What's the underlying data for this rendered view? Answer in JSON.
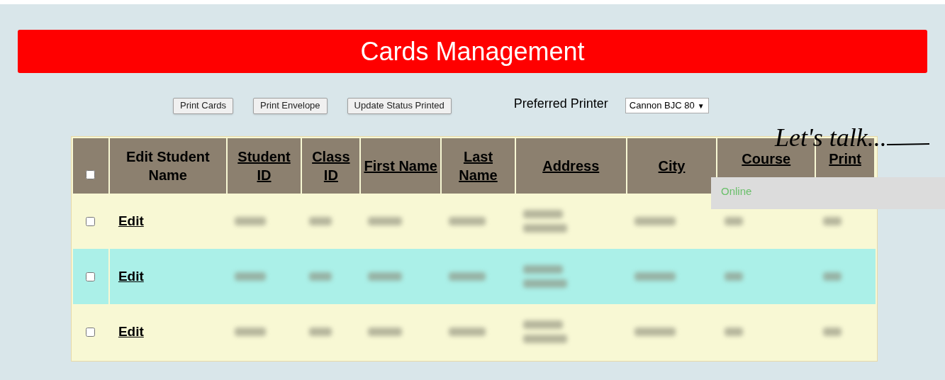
{
  "banner": {
    "title": "Cards Management"
  },
  "toolbar": {
    "buttons": [
      "Print Cards",
      "Print Envelope",
      "Update Status Printed"
    ],
    "printer_label": "Preferred Printer",
    "printer_value": "Cannon BJC 80",
    "dropdown_arrow": "▼"
  },
  "table": {
    "select_all": {
      "checked": false
    },
    "columns": [
      {
        "label": "Edit Student Name",
        "sortable": false
      },
      {
        "label": "Student ID",
        "sortable": true
      },
      {
        "label": "Class ID",
        "sortable": true
      },
      {
        "label": "First Name",
        "sortable": true
      },
      {
        "label": "Last Name",
        "sortable": true
      },
      {
        "label": "Address",
        "sortable": true
      },
      {
        "label": "City",
        "sortable": true
      },
      {
        "label": "Course",
        "sortable": true
      },
      {
        "label": "Print",
        "sortable": true
      }
    ],
    "rows": [
      {
        "checked": false,
        "selected": false,
        "edit_link": "Edit"
      },
      {
        "checked": false,
        "selected": true,
        "edit_link": "Edit"
      },
      {
        "checked": false,
        "selected": false,
        "edit_link": "Edit"
      }
    ]
  },
  "chat_widget": {
    "tagline": "Let's talk...",
    "status": "Online"
  }
}
